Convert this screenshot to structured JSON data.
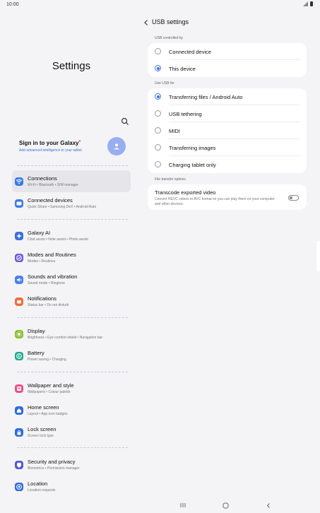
{
  "status": {
    "time": "10:00"
  },
  "settings_app": {
    "title": "Settings",
    "account": {
      "title": "Sign in to your Galaxy",
      "subtitle": "Add advanced intelligence to your tablet."
    },
    "items": [
      {
        "label": "Connections",
        "sub": "Wi-Fi • Bluetooth • SIM manager",
        "color": "#3a7bea",
        "icon": "wifi-icon"
      },
      {
        "label": "Connected devices",
        "sub": "Quick Share • Samsung DeX • Android Auto",
        "color": "#3a7bea",
        "icon": "devices-icon"
      },
      {
        "label": "Galaxy AI",
        "sub": "Chat assist • Note assist • Photo assist",
        "color": "#3d6ee0",
        "icon": "sparkle-icon"
      },
      {
        "label": "Modes and Routines",
        "sub": "Modes • Routines",
        "color": "#6b5ae0",
        "icon": "check-circle-icon"
      },
      {
        "label": "Sounds and vibration",
        "sub": "Sound mode • Ringtone",
        "color": "#4a7ff0",
        "icon": "speaker-icon"
      },
      {
        "label": "Notifications",
        "sub": "Status bar • Do not disturb",
        "color": "#f26a3d",
        "icon": "bell-icon"
      },
      {
        "label": "Display",
        "sub": "Brightness • Eye comfort shield • Navigation bar",
        "color": "#8bbf2d",
        "icon": "sun-icon"
      },
      {
        "label": "Battery",
        "sub": "Power saving • Charging",
        "color": "#1fa88a",
        "icon": "battery-icon"
      },
      {
        "label": "Wallpaper and style",
        "sub": "Wallpapers • Colour palette",
        "color": "#ee4f87",
        "icon": "wallpaper-icon"
      },
      {
        "label": "Home screen",
        "sub": "Layout • App icon badges",
        "color": "#2e6be0",
        "icon": "home-icon"
      },
      {
        "label": "Lock screen",
        "sub": "Screen lock type",
        "color": "#2e6be0",
        "icon": "lock-icon"
      },
      {
        "label": "Security and privacy",
        "sub": "Biometrics • Permission manager",
        "color": "#5a55d8",
        "icon": "shield-icon"
      },
      {
        "label": "Location",
        "sub": "Location requests",
        "color": "#2e6be0",
        "icon": "location-icon"
      }
    ]
  },
  "usb": {
    "title": "USB settings",
    "controlled_by": {
      "label": "USB controlled by",
      "options": [
        "Connected device",
        "This device"
      ],
      "selected": "This device"
    },
    "use_for": {
      "label": "Use USB for",
      "options": [
        "Transferring files / Android Auto",
        "USB tethering",
        "MIDI",
        "Transferring images",
        "Charging tablet only"
      ],
      "selected": "Transferring files / Android Auto"
    },
    "file_transfer": {
      "label": "File transfer options",
      "title": "Transcode exported video",
      "desc": "Convert HEVC videos to AVC format so you can play them on your computer and other devices.",
      "enabled": false
    }
  },
  "accent": "#3d6ee0"
}
